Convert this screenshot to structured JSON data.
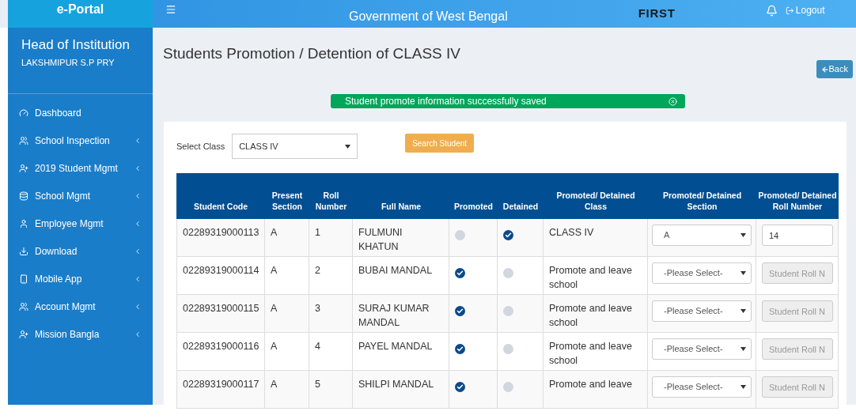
{
  "header": {
    "brand": "e-Portal",
    "title": "Government of West Bengal",
    "logo_text": "FIRST",
    "logout": "Logout"
  },
  "sidebar": {
    "role": "Head of Institution",
    "school": "LAKSHMIPUR S.P PRY",
    "items": [
      {
        "label": "Dashboard",
        "expandable": false
      },
      {
        "label": "School Inspection",
        "expandable": true
      },
      {
        "label": "2019 Student Mgmt",
        "expandable": true
      },
      {
        "label": "School Mgmt",
        "expandable": true
      },
      {
        "label": "Employee Mgmt",
        "expandable": true
      },
      {
        "label": "Download",
        "expandable": true
      },
      {
        "label": "Mobile App",
        "expandable": true
      },
      {
        "label": "Account Mgmt",
        "expandable": true
      },
      {
        "label": "Mission Bangla",
        "expandable": true
      }
    ]
  },
  "page_title": "Students Promotion / Detention of CLASS IV",
  "back_button": "Back",
  "alert": {
    "message": "Student promote information successfully saved"
  },
  "filter": {
    "label": "Select Class",
    "value": "CLASS IV",
    "button": "Search Student"
  },
  "table": {
    "columns": [
      "Student Code",
      "Present Section",
      "Roll Number",
      "Full Name",
      "Promoted",
      "Detained",
      "Promoted/ Detained Class",
      "Promoted/ Detained Section",
      "Promoted/ Detained Roll Number"
    ],
    "rows": [
      {
        "code": "02289319000113",
        "section": "A",
        "roll": "1",
        "name": "FULMUNI KHATUN",
        "promoted": false,
        "detained": true,
        "class": "CLASS IV",
        "new_section": {
          "value": "A"
        },
        "new_roll": {
          "value": "14",
          "disabled": false
        }
      },
      {
        "code": "02289319000114",
        "section": "A",
        "roll": "2",
        "name": "BUBAI MANDAL",
        "promoted": true,
        "detained": false,
        "class": "Promote and leave school",
        "new_section": {
          "placeholder": "-Please Select-"
        },
        "new_roll": {
          "placeholder": "Student Roll N",
          "disabled": true
        }
      },
      {
        "code": "02289319000115",
        "section": "A",
        "roll": "3",
        "name": "SURAJ KUMAR MANDAL",
        "promoted": true,
        "detained": false,
        "class": "Promote and leave school",
        "new_section": {
          "placeholder": "-Please Select-"
        },
        "new_roll": {
          "placeholder": "Student Roll N",
          "disabled": true
        }
      },
      {
        "code": "02289319000116",
        "section": "A",
        "roll": "4",
        "name": "PAYEL MANDAL",
        "promoted": true,
        "detained": false,
        "class": "Promote and leave school",
        "new_section": {
          "placeholder": "-Please Select-"
        },
        "new_roll": {
          "placeholder": "Student Roll N",
          "disabled": true
        }
      },
      {
        "code": "02289319000117",
        "section": "A",
        "roll": "5",
        "name": "SHILPI MANDAL",
        "promoted": true,
        "detained": false,
        "class": "Promote and leave",
        "new_section": {
          "placeholder": "-Please Select-"
        },
        "new_roll": {
          "placeholder": "Student Roll N",
          "disabled": true
        }
      }
    ]
  }
}
